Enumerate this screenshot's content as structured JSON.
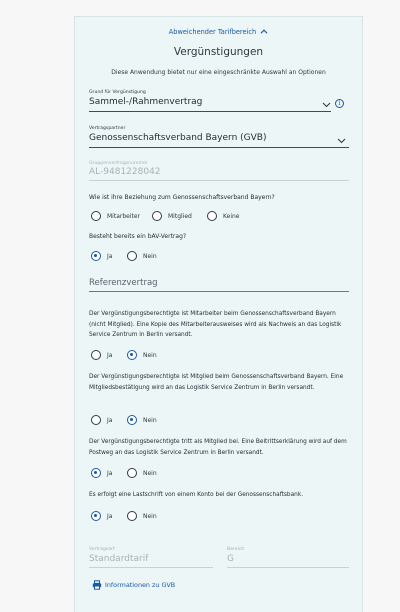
{
  "section": {
    "toggle_label": "Abweichender Tarifbereich",
    "title": "Vergünstigungen",
    "subtitle": "Diese Anwendung bietet nur eine eingeschränkte Auswahl an Optionen"
  },
  "grund": {
    "label": "Grund für Vergünstigung",
    "value": "Sammel-/Rahmenvertrag"
  },
  "partner": {
    "label": "Vertragspartner",
    "value": "Genossenschaftsverband Bayern (GVB)"
  },
  "gruppe": {
    "label": "Gruppenvertragsnummer",
    "value": "AL-9481228042"
  },
  "q_beziehung": {
    "text": "Wie ist ihre Beziehung zum Genossenschaftsverband Bayern?",
    "options": [
      "Mitarbeiter",
      "Mitglied",
      "Keine"
    ],
    "selected": null
  },
  "q_bav": {
    "text": "Besteht bereits ein bAV-Vertrag?",
    "options": [
      "Ja",
      "Nein"
    ],
    "selected": "Ja"
  },
  "referenz": {
    "placeholder": "Referenzvertrag"
  },
  "q_mitarbeiter": {
    "text": "Der Vergünstigungsberechtigte ist Mitarbeiter beim Genossenschaftsverband Bayern (nicht Mitglied). Eine Kopie des Mitarbeiterausweises wird als Nachweis an das Logistik Service Zentrum in Berlin versandt.",
    "options": [
      "Ja",
      "Nein"
    ],
    "selected": "Nein"
  },
  "q_mitglied": {
    "text": "Der Vergünstigungsberechtigte ist Mitglied beim Genossenschaftsverband Bayern. Eine Mitgliedsbestätigung wird an das Logistik Service Zentrum in Berlin versandt.",
    "options": [
      "Ja",
      "Nein"
    ],
    "selected": "Nein"
  },
  "q_beitritt": {
    "text": "Der Vergünstigungsberechtigte tritt als Mitglied bei. Eine Beitrittserklärung wird auf dem Postweg an das Logistik Service Zentrum in Berlin versandt.",
    "options": [
      "Ja",
      "Nein"
    ],
    "selected": "Ja"
  },
  "q_lastschrift": {
    "text": "Es erfolgt eine Lastschrift von einem Konto bei der Genossenschaftsbank.",
    "options": [
      "Ja",
      "Nein"
    ],
    "selected": "Ja"
  },
  "vertragsart": {
    "label": "Vertragsart",
    "value": "Standardtarif"
  },
  "bereich": {
    "label": "Bereich",
    "value": "G"
  },
  "info_link": {
    "label": "Informationen zu GVB"
  },
  "colors": {
    "accent": "#1a5aa6",
    "panel": "#ecf6f6"
  }
}
